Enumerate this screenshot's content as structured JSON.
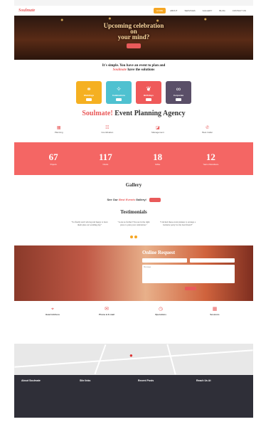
{
  "nav": {
    "logo": "Soulmate",
    "menu": [
      "HOME",
      "ABOUT",
      "SERVICES",
      "GALLERY",
      "BLOG",
      "CONTACT US"
    ]
  },
  "hero": {
    "title_lines": [
      "Upcoming celebration",
      "on",
      "your mind?"
    ]
  },
  "intro": {
    "line1": "It's simple. You have an event to plan and",
    "brand": "Soulmate",
    "line2": "have the solutions"
  },
  "cards": [
    {
      "title": "Weddings",
      "icon": "rings-icon",
      "color": "#f5b021"
    },
    {
      "title": "Celebrations",
      "icon": "party-icon",
      "color": "#4fc1d0"
    },
    {
      "title": "Birthdays",
      "icon": "balloons-icon",
      "color": "#ef5a5a"
    },
    {
      "title": "Corporate",
      "icon": "handshake-icon",
      "color": "#5a4f68"
    }
  ],
  "agency": {
    "brand": "Soulmate!",
    "title": "Event Planning Agency"
  },
  "features": [
    {
      "label": "Planning",
      "icon": "calendar-icon"
    },
    {
      "label": "Coordination",
      "icon": "people-icon"
    },
    {
      "label": "Management",
      "icon": "chart-icon"
    },
    {
      "label": "Best Caller",
      "icon": "phone-icon"
    }
  ],
  "stats": [
    {
      "value": "67",
      "label": "Projects"
    },
    {
      "value": "117",
      "label": "Clients"
    },
    {
      "value": "18",
      "label": "Coffee"
    },
    {
      "value": "12",
      "label": "Years of Excellence"
    }
  ],
  "gallery": {
    "title": "Gallery",
    "cta_prefix": "See Our",
    "cta_em": "Best Events",
    "cta_suffix": "Gallery!"
  },
  "testimonials": {
    "title": "Testimonials",
    "items": [
      {
        "quote": "\"So finally and I am beyond happy to have them plan our wedding day\""
      },
      {
        "quote": "\"Look no further! You are in the right place to plan your celebration.\""
      },
      {
        "quote": "\"I invited these event planner to arrange a bachelor party for my best friend!\""
      }
    ]
  },
  "online_request": {
    "title": "Online Request",
    "message_placeholder": "Message"
  },
  "contact": [
    {
      "title": "Head Address",
      "icon": "location-icon"
    },
    {
      "title": "Phone & E-mail",
      "icon": "mail-icon"
    },
    {
      "title": "Operations",
      "icon": "clock-icon"
    },
    {
      "title": "Sessions",
      "icon": "calendar-icon"
    }
  ],
  "footer": {
    "about_title": "About Soulmate",
    "links_title": "Site links",
    "posts_title": "Recent Posts",
    "reach_title": "Reach Us At"
  }
}
